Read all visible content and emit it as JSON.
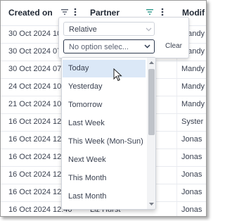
{
  "table": {
    "columns": [
      {
        "label": "Created on"
      },
      {
        "label": "Partner"
      },
      {
        "label": "Modif"
      }
    ],
    "rows": [
      {
        "created": "30 Oct 2024 10:",
        "partner": "",
        "modified": "Mandy"
      },
      {
        "created": "30 Oct 2024 07",
        "partner": "",
        "modified": "Mandy"
      },
      {
        "created": "30 Oct 2024 07:",
        "partner": "",
        "modified": "Mandy"
      },
      {
        "created": "24 Oct 2024 10:",
        "partner": "",
        "modified": "Mandy"
      },
      {
        "created": "21 Oct 2024 10:",
        "partner": "",
        "modified": "Mandy"
      },
      {
        "created": "16 Oct 2024 12:",
        "partner": "",
        "modified": "Syster"
      },
      {
        "created": "16 Oct 2024 12:",
        "partner": "",
        "modified": "Jonas"
      },
      {
        "created": "16 Oct 2024 12:",
        "partner": "",
        "modified": "Jonas"
      },
      {
        "created": "16 Oct 2024 12:",
        "partner": "",
        "modified": "Jonas"
      },
      {
        "created": "16 Oct 2024 12:",
        "partner": "",
        "modified": "Jonas"
      },
      {
        "created": "16 Oct 2024 12:40",
        "partner": "Liz Hurst",
        "modified": "Jonas"
      }
    ]
  },
  "filter_panel": {
    "mode_value": "Relative",
    "option_placeholder": "No option selec...",
    "clear_label": "Clear"
  },
  "dropdown": {
    "options": [
      {
        "label": "Today",
        "highlighted": true
      },
      {
        "label": "Yesterday"
      },
      {
        "label": "Tomorrow"
      },
      {
        "label": "Last Week"
      },
      {
        "label": "This Week (Mon-Sun)"
      },
      {
        "label": "Next Week"
      },
      {
        "label": "This Month"
      },
      {
        "label": "Last Month"
      }
    ]
  },
  "colors": {
    "active_filter_icon": "#2e9a8c",
    "highlight": "#dbe8f7",
    "header_text": "#1f2733"
  },
  "icons": [
    "filter-icon",
    "kebab-menu-icon",
    "chevron-down-icon",
    "mouse-pointer-icon"
  ]
}
